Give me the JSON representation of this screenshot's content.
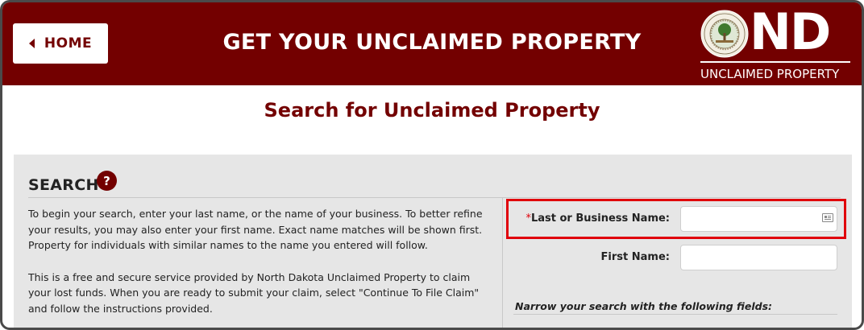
{
  "header": {
    "home_label": "HOME",
    "title": "GET YOUR UNCLAIMED PROPERTY",
    "logo_letters": "ND",
    "logo_subtitle": "UNCLAIMED PROPERTY",
    "seal_text": "GREAT SEAL · STATE OF NORTH DAKOTA",
    "brand_color": "#730000"
  },
  "page": {
    "heading": "Search for Unclaimed Property"
  },
  "search": {
    "title": "SEARCH",
    "help_icon": "?",
    "intro_paragraph_1": "To begin your search, enter your last name, or the name of your business. To better refine your results, you may also enter your first name. Exact name matches will be shown first. Property for individuals with similar names to the name you entered will follow.",
    "intro_paragraph_2": "This is a free and secure service provided by North Dakota Unclaimed Property to claim your lost funds. When you are ready to submit your claim, select \"Continue To File Claim\" and follow the instructions provided.",
    "required_mark": "*",
    "last_name_label": "Last or Business Name:",
    "last_name_value": "",
    "first_name_label": "First Name:",
    "first_name_value": "",
    "narrow_label": "Narrow your search with the following fields:",
    "highlight_color": "#e0000b"
  }
}
